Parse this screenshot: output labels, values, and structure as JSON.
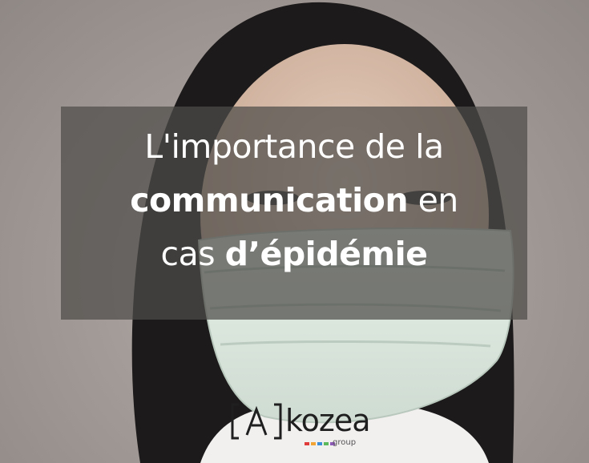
{
  "title": {
    "line1": "L'importance de la",
    "line2_bold": "communication",
    "line2_rest": " en",
    "line3_plain": "cas ",
    "line3_bold": "d’épidémie"
  },
  "logo": {
    "word": "kozea",
    "sub": "group",
    "dot_colors": [
      "#e03b3b",
      "#f2a534",
      "#3a8fd8",
      "#5bb85b",
      "#8e5bb8"
    ]
  }
}
